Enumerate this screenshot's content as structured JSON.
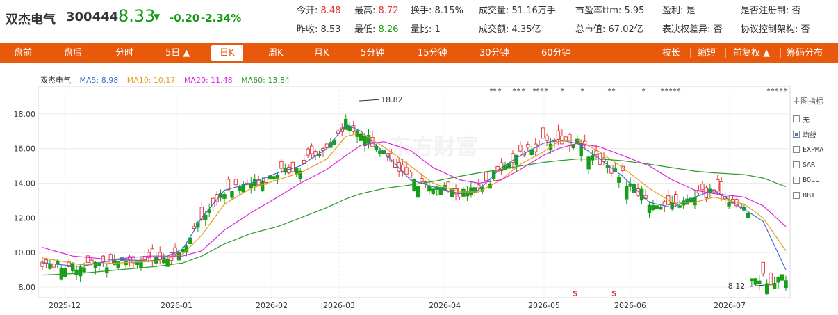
{
  "stock": {
    "name": "双杰电气",
    "code": "300444",
    "price": "8.33",
    "arrow": "▼",
    "change": "-0.20",
    "change_pct": "-2.34%"
  },
  "stats_row1": [
    {
      "label": "今开:",
      "value": "8.48",
      "tone": "red"
    },
    {
      "label": "最高:",
      "value": "8.72",
      "tone": "red"
    },
    {
      "label": "换手:",
      "value": "8.15%",
      "tone": "none"
    },
    {
      "label": "成交量:",
      "value": "51.16万手",
      "tone": "none"
    },
    {
      "label": "市盈率ttm:",
      "value": "5.95",
      "tone": "none"
    },
    {
      "label": "盈利:",
      "value": "是",
      "tone": "none"
    },
    {
      "label": "是否注册制:",
      "value": "否",
      "tone": "none"
    }
  ],
  "stats_row2": [
    {
      "label": "昨收:",
      "value": "8.53",
      "tone": "none"
    },
    {
      "label": "最低:",
      "value": "8.26",
      "tone": "green"
    },
    {
      "label": "量比:",
      "value": "1",
      "tone": "none"
    },
    {
      "label": "成交额:",
      "value": "4.35亿",
      "tone": "none"
    },
    {
      "label": "总市值:",
      "value": "67.02亿",
      "tone": "none"
    },
    {
      "label": "表决权差异:",
      "value": "否",
      "tone": "none"
    },
    {
      "label": "协议控制架构:",
      "value": "否",
      "tone": "none"
    }
  ],
  "toolbar": {
    "left": [
      "盘前",
      "盘后",
      "分时",
      "5日 ▲",
      "日K",
      "周K",
      "月K",
      "5分钟",
      "15分钟",
      "30分钟",
      "60分钟"
    ],
    "active": "日K",
    "right": [
      "拉长",
      "缩短",
      "前复权 ▲",
      "筹码分布"
    ]
  },
  "legend": {
    "name": "双杰电气",
    "items": [
      {
        "label": "MA5: 8.98",
        "color": "#3d6fd6"
      },
      {
        "label": "MA10: 10.17",
        "color": "#e69c1f"
      },
      {
        "label": "MA20: 11.48",
        "color": "#e01fe0"
      },
      {
        "label": "MA60: 13.84",
        "color": "#2a9a2a"
      }
    ]
  },
  "side_panel": {
    "title": "主图指标",
    "items": [
      {
        "label": "无",
        "checked": false
      },
      {
        "label": "均线",
        "checked": true
      },
      {
        "label": "EXPMA",
        "checked": false
      },
      {
        "label": "SAR",
        "checked": false
      },
      {
        "label": "BOLL",
        "checked": false
      },
      {
        "label": "BBI",
        "checked": false
      }
    ]
  },
  "watermark": "东方财富",
  "chart_data": {
    "type": "candlestick",
    "x_ticks": [
      "2025-12",
      "2026-01",
      "2026-02",
      "2026-03",
      "2026-04",
      "2026-05",
      "2026-06",
      "2026-07"
    ],
    "y_ticks": [
      "8.00",
      "10.00",
      "12.00",
      "14.00",
      "16.00",
      "18.00"
    ],
    "y_range": [
      7.4,
      19.6
    ],
    "annotations": {
      "high": "18.82",
      "low": "8.12"
    },
    "ma_waypoints": {
      "ma5": [
        [
          0,
          9.4
        ],
        [
          10,
          9.2
        ],
        [
          20,
          9.6
        ],
        [
          30,
          9.5
        ],
        [
          37,
          10.2
        ],
        [
          42,
          12.0
        ],
        [
          48,
          13.6
        ],
        [
          55,
          14.0
        ],
        [
          62,
          14.6
        ],
        [
          68,
          15.0
        ],
        [
          75,
          16.0
        ],
        [
          80,
          17.4
        ],
        [
          84,
          17.0
        ],
        [
          90,
          15.8
        ],
        [
          97,
          14.2
        ],
        [
          103,
          13.8
        ],
        [
          110,
          13.4
        ],
        [
          115,
          13.6
        ],
        [
          121,
          14.9
        ],
        [
          126,
          15.6
        ],
        [
          132,
          16.3
        ],
        [
          136,
          16.5
        ],
        [
          141,
          16.3
        ],
        [
          147,
          15.4
        ],
        [
          153,
          14.4
        ],
        [
          160,
          12.9
        ],
        [
          166,
          12.6
        ],
        [
          172,
          13.2
        ],
        [
          177,
          13.6
        ],
        [
          185,
          12.5
        ],
        [
          190,
          11.8
        ],
        [
          196,
          9.0
        ]
      ],
      "ma10": [
        [
          0,
          9.7
        ],
        [
          10,
          9.3
        ],
        [
          20,
          9.4
        ],
        [
          30,
          9.5
        ],
        [
          37,
          9.9
        ],
        [
          42,
          11.0
        ],
        [
          48,
          12.8
        ],
        [
          55,
          13.7
        ],
        [
          62,
          14.2
        ],
        [
          68,
          14.6
        ],
        [
          75,
          15.4
        ],
        [
          80,
          16.7
        ],
        [
          84,
          16.9
        ],
        [
          90,
          16.1
        ],
        [
          97,
          15.0
        ],
        [
          103,
          14.0
        ],
        [
          110,
          13.5
        ],
        [
          115,
          13.5
        ],
        [
          121,
          14.2
        ],
        [
          126,
          15.1
        ],
        [
          132,
          15.8
        ],
        [
          136,
          16.4
        ],
        [
          141,
          16.5
        ],
        [
          147,
          15.8
        ],
        [
          153,
          14.9
        ],
        [
          160,
          13.7
        ],
        [
          166,
          12.9
        ],
        [
          172,
          12.9
        ],
        [
          177,
          13.2
        ],
        [
          185,
          12.8
        ],
        [
          190,
          12.0
        ],
        [
          196,
          10.1
        ]
      ],
      "ma20": [
        [
          0,
          10.3
        ],
        [
          8,
          9.8
        ],
        [
          18,
          9.6
        ],
        [
          28,
          9.8
        ],
        [
          37,
          9.8
        ],
        [
          42,
          10.1
        ],
        [
          48,
          11.3
        ],
        [
          55,
          12.3
        ],
        [
          62,
          13.2
        ],
        [
          68,
          14.0
        ],
        [
          75,
          14.8
        ],
        [
          80,
          15.6
        ],
        [
          84,
          16.2
        ],
        [
          90,
          16.4
        ],
        [
          97,
          15.9
        ],
        [
          103,
          14.9
        ],
        [
          110,
          14.2
        ],
        [
          115,
          14.0
        ],
        [
          121,
          14.2
        ],
        [
          126,
          14.8
        ],
        [
          132,
          15.6
        ],
        [
          136,
          16.0
        ],
        [
          141,
          16.3
        ],
        [
          147,
          16.1
        ],
        [
          153,
          15.6
        ],
        [
          160,
          15.0
        ],
        [
          166,
          14.2
        ],
        [
          172,
          13.6
        ],
        [
          177,
          13.4
        ],
        [
          185,
          13.2
        ],
        [
          190,
          12.7
        ],
        [
          196,
          11.5
        ]
      ],
      "ma60": [
        [
          0,
          8.7
        ],
        [
          10,
          8.8
        ],
        [
          20,
          9.0
        ],
        [
          30,
          9.2
        ],
        [
          37,
          9.4
        ],
        [
          42,
          9.8
        ],
        [
          48,
          10.5
        ],
        [
          55,
          11.1
        ],
        [
          62,
          11.5
        ],
        [
          68,
          12.0
        ],
        [
          75,
          12.6
        ],
        [
          80,
          13.1
        ],
        [
          84,
          13.4
        ],
        [
          90,
          13.7
        ],
        [
          97,
          13.9
        ],
        [
          103,
          14.1
        ],
        [
          110,
          14.4
        ],
        [
          115,
          14.6
        ],
        [
          121,
          14.8
        ],
        [
          126,
          15.0
        ],
        [
          132,
          15.2
        ],
        [
          136,
          15.3
        ],
        [
          141,
          15.4
        ],
        [
          147,
          15.4
        ],
        [
          153,
          15.3
        ],
        [
          160,
          15.1
        ],
        [
          166,
          14.9
        ],
        [
          172,
          14.7
        ],
        [
          177,
          14.6
        ],
        [
          185,
          14.5
        ],
        [
          190,
          14.3
        ],
        [
          196,
          13.8
        ]
      ]
    }
  }
}
